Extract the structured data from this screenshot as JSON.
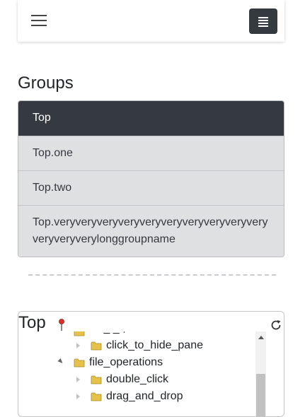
{
  "groups": {
    "heading": "Groups",
    "items": [
      {
        "label": "Top"
      },
      {
        "label": "Top.one"
      },
      {
        "label": "Top.two"
      },
      {
        "label": "Top.veryveryveryveryveryveryveryveryveryveryveryveryverylonggroupname"
      }
    ]
  },
  "tree": {
    "title": "Top",
    "nodes": [
      {
        "label": "click_to_hide_pane"
      },
      {
        "label": "file_operations"
      },
      {
        "label": "double_click"
      },
      {
        "label": "drag_and_drop"
      }
    ]
  },
  "colors": {
    "active": "#343a40",
    "item_bg": "#dfe0e2",
    "folder": "#e6c24d"
  }
}
